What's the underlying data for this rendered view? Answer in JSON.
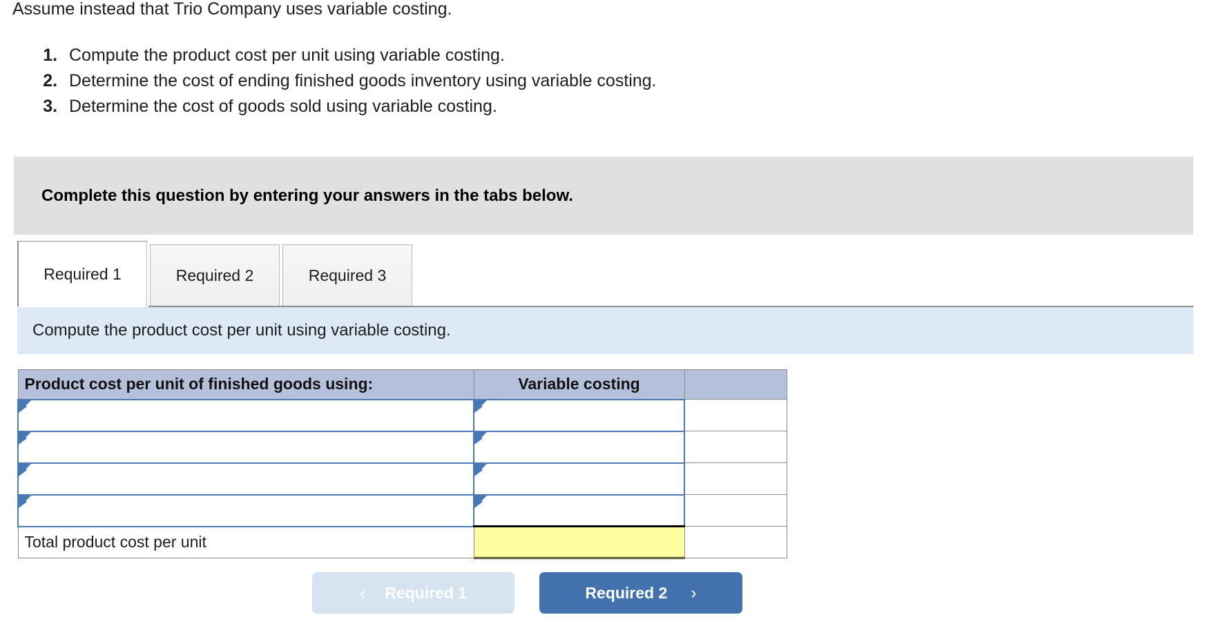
{
  "intro": {
    "lead": "Assume instead that Trio Company uses variable costing.",
    "requirements": [
      "Compute the product cost per unit using variable costing.",
      "Determine the cost of ending finished goods inventory using variable costing.",
      "Determine the cost of goods sold using variable costing."
    ]
  },
  "banner": {
    "text": "Complete this question by entering your answers in the tabs below."
  },
  "tabs": [
    {
      "label": "Required 1",
      "active": true
    },
    {
      "label": "Required 2",
      "active": false
    },
    {
      "label": "Required 3",
      "active": false
    }
  ],
  "subbar": {
    "text": "Compute the product cost per unit using variable costing."
  },
  "table": {
    "headers": [
      "Product cost per unit of finished goods using:",
      "Variable costing",
      ""
    ],
    "entry_rows": [
      {
        "label": "",
        "value": ""
      },
      {
        "label": "",
        "value": ""
      },
      {
        "label": "",
        "value": ""
      },
      {
        "label": "",
        "value": ""
      }
    ],
    "total_row": {
      "label": "Total product cost per unit",
      "value": ""
    }
  },
  "nav": {
    "prev_label": "Required 1",
    "next_label": "Required 2",
    "prev_icon": "chevron-left-icon",
    "next_icon": "chevron-right-icon",
    "prev_chevron": "‹",
    "next_chevron": "›"
  },
  "colors": {
    "banner_gray": "#e0e0e0",
    "subbar_blue": "#dde9f7",
    "table_header": "#b5c0da",
    "entry_border": "#4c7ab5",
    "total_yellow": "#ffffa0",
    "next_button": "#4271ad",
    "prev_button": "#d6e3f0"
  }
}
